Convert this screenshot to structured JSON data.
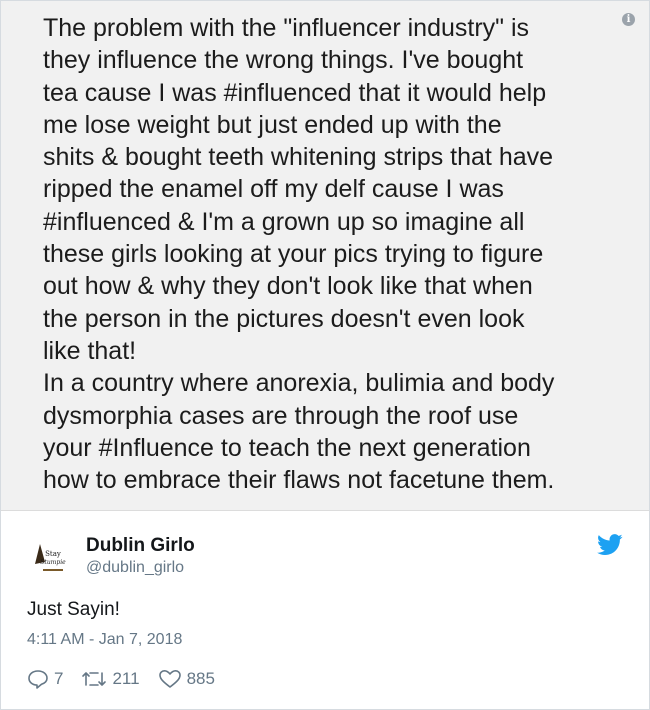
{
  "quote": {
    "text": "The problem with the \"influencer industry\" is\nthey influence the wrong things. I've bought\ntea cause I was #influenced that it would help\nme lose weight but just ended up with the\nshits & bought teeth whitening strips that have\nripped the enamel off my delf cause I was\n#influenced & I'm a grown up so imagine all\nthese girls looking at your pics trying to figure\nout how & why they don't look like that when\nthe person in the pictures doesn't even look\nlike that!\nIn a country where anorexia, bulimia and body\ndysmorphia cases are through the roof use\nyour #Influence to teach the next generation\nhow to embrace their flaws not facetune them."
  },
  "tweet": {
    "display_name": "Dublin Girlo",
    "handle": "@dublin_girlo",
    "avatar_text": "Stay Stumpie",
    "body": "Just Sayin!",
    "timestamp": "4:11 AM - Jan 7, 2018",
    "replies": "7",
    "retweets": "211",
    "likes": "885"
  },
  "icons": {
    "info": "info-icon",
    "twitter": "twitter-bird-icon",
    "reply": "reply-icon",
    "retweet": "retweet-icon",
    "like": "heart-icon"
  },
  "colors": {
    "quote_bg": "#f1f1f1",
    "twitter_blue": "#1da1f2",
    "muted": "#657786"
  }
}
